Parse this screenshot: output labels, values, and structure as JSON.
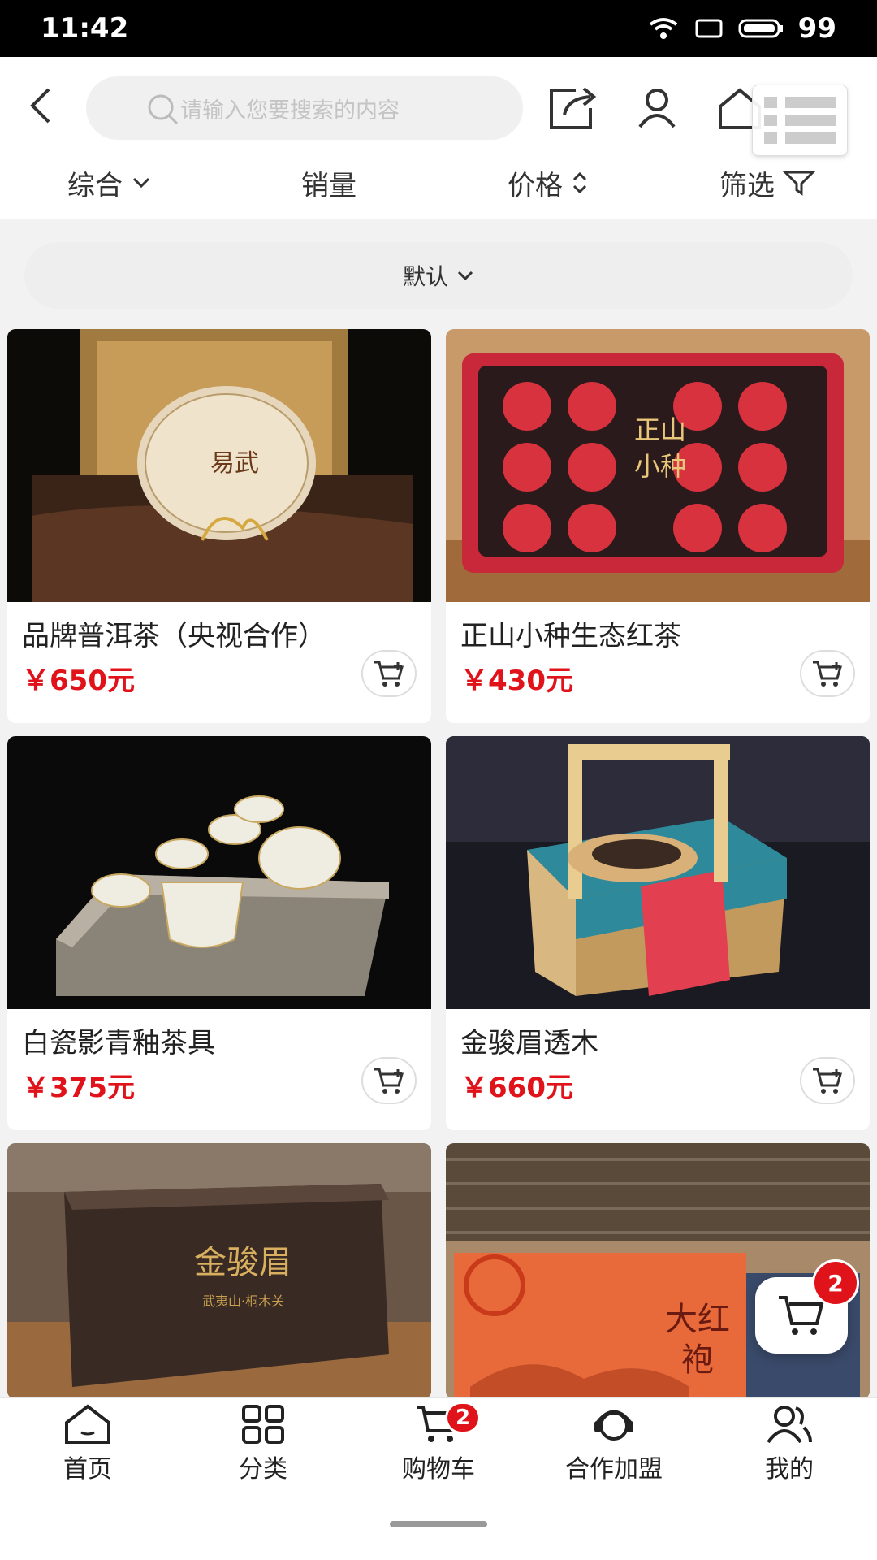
{
  "status": {
    "time": "11:42",
    "battery": "99"
  },
  "header": {
    "search_placeholder": "请输入您要搜索的内容",
    "icons": [
      "back-icon",
      "search-icon",
      "share-icon",
      "user-icon",
      "home-icon",
      "more-icon"
    ]
  },
  "sort": {
    "items": [
      {
        "label": "综合",
        "icon": "chevron-down-icon"
      },
      {
        "label": "销量",
        "icon": ""
      },
      {
        "label": "价格",
        "icon": "sort-updown-icon"
      },
      {
        "label": "筛选",
        "icon": "filter-icon"
      }
    ]
  },
  "filter": {
    "label": "默认"
  },
  "products": [
    {
      "name": "品牌普洱茶（央视合作）",
      "price": "￥650元"
    },
    {
      "name": "正山小种生态红茶",
      "price": "￥430元"
    },
    {
      "name": "白瓷影青釉茶具",
      "price": "￥375元"
    },
    {
      "name": "金骏眉透木",
      "price": "￥660元"
    },
    {
      "name": "",
      "price": ""
    },
    {
      "name": "",
      "price": ""
    }
  ],
  "float_cart": {
    "count": "2"
  },
  "tabbar": {
    "items": [
      {
        "label": "首页",
        "icon": "home-icon"
      },
      {
        "label": "分类",
        "icon": "grid-icon"
      },
      {
        "label": "购物车",
        "icon": "cart-icon",
        "badge": "2"
      },
      {
        "label": "合作加盟",
        "icon": "support-icon"
      },
      {
        "label": "我的",
        "icon": "users-icon"
      }
    ]
  },
  "colors": {
    "accent": "#e0121a",
    "background": "#f2f2f2"
  }
}
